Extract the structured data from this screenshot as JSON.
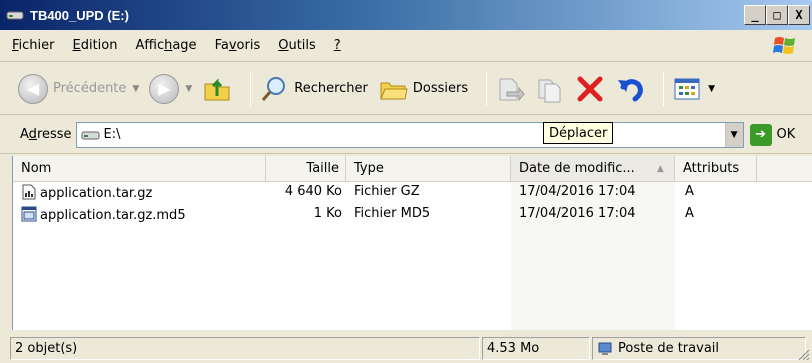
{
  "window": {
    "title": "TB400_UPD (E:)",
    "buttons": [
      "_",
      "□",
      "X"
    ]
  },
  "menu": [
    {
      "key": "fichier",
      "pre": "",
      "accel": "F",
      "post": "ichier"
    },
    {
      "key": "edition",
      "pre": "",
      "accel": "E",
      "post": "dition"
    },
    {
      "key": "affichage",
      "pre": "Affic",
      "accel": "h",
      "post": "age"
    },
    {
      "key": "favoris",
      "pre": "Fa",
      "accel": "v",
      "post": "oris"
    },
    {
      "key": "outils",
      "pre": "",
      "accel": "O",
      "post": "utils"
    },
    {
      "key": "aide",
      "pre": "",
      "accel": "?",
      "post": ""
    }
  ],
  "toolbar": {
    "back_label": "Précédente",
    "search_label": "Rechercher",
    "folders_label": "Dossiers"
  },
  "address": {
    "label_pre": "A",
    "label_accel": "d",
    "label_post": "resse",
    "value": "E:\\",
    "go_label": "OK",
    "tooltip": "Déplacer"
  },
  "columns": {
    "name": "Nom",
    "size": "Taille",
    "type": "Type",
    "date": "Date de modific...",
    "attributes": "Attributs"
  },
  "files": [
    {
      "name": "application.tar.gz",
      "size": "4 640 Ko",
      "type": "Fichier GZ",
      "date": "17/04/2016 17:04",
      "attr": "A"
    },
    {
      "name": "application.tar.gz.md5",
      "size": "1 Ko",
      "type": "Fichier MD5",
      "date": "17/04/2016 17:04",
      "attr": "A"
    }
  ],
  "status": {
    "count": "2 objet(s)",
    "size": "4.53 Mo",
    "zone": "Poste de travail"
  },
  "colors": {
    "title_start": "#0a246a",
    "title_end": "#a6caf0",
    "delete_red": "#e02020",
    "undo_blue": "#1a4fd0"
  }
}
